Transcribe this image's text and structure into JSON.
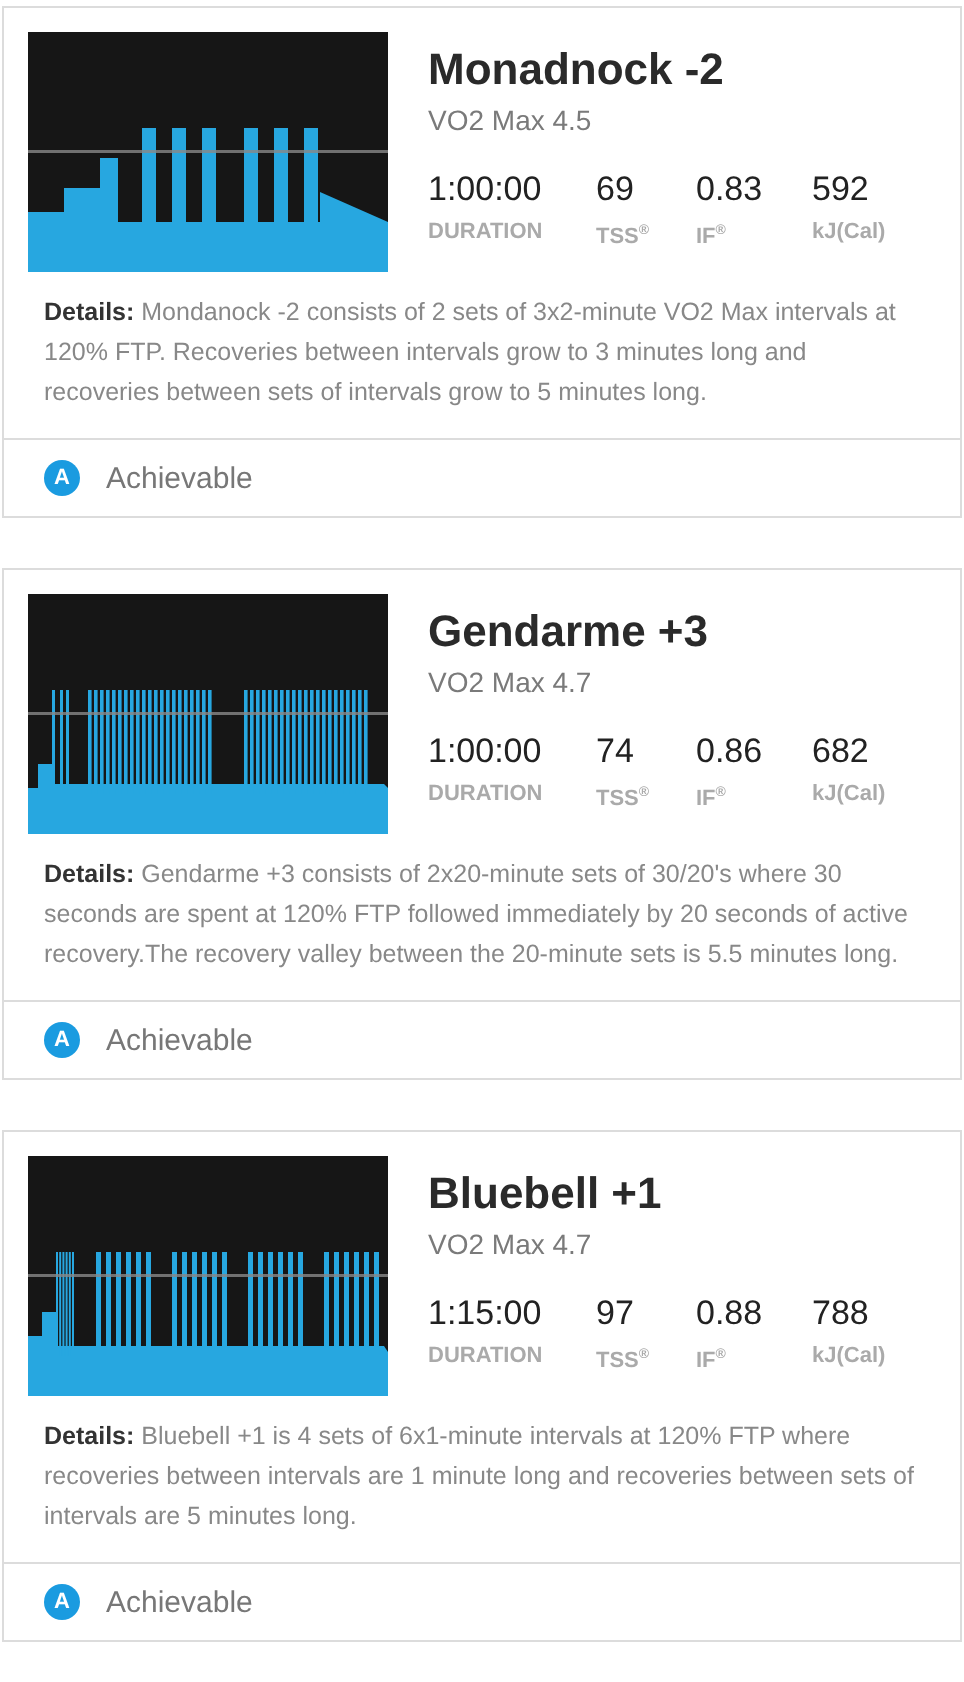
{
  "workouts": [
    {
      "title": "Monadnock -2",
      "subtitle": "VO2 Max 4.5",
      "stats": [
        {
          "value": "1:00:00",
          "label": "DURATION"
        },
        {
          "value": "69",
          "label": "TSS$^{®}$"
        },
        {
          "value": "0.83",
          "label": "IF$^{®}$"
        },
        {
          "value": "592",
          "label": "kJ(Cal)"
        }
      ],
      "details": "**Details:** Mondanock -2 consists of 2 sets of 3x2-minute VO2 Max intervals at 120% FTP. Recoveries between intervals grow to 3 minutes long and recoveries between sets of intervals grow to 5 minutes long.",
      "badge": "A",
      "difficulty": "Achievable"
    },
    {
      "title": "Gendarme +3",
      "subtitle": "VO2 Max 4.7",
      "stats": [
        {
          "value": "1:00:00",
          "label": "DURATION"
        },
        {
          "value": "74",
          "label": "TSS$^{®}$"
        },
        {
          "value": "0.86",
          "label": "IF$^{®}$"
        },
        {
          "value": "682",
          "label": "kJ(Cal)"
        }
      ],
      "details": "**Details:** Gendarme +3 consists of 2x20-minute sets of 30/20's where 30 seconds are spent at 120% FTP followed immediately by 20 seconds of active recovery.The recovery valley between the 20-minute sets is 5.5 minutes long.",
      "badge": "A",
      "difficulty": "Achievable"
    },
    {
      "title": "Bluebell +1",
      "subtitle": "VO2 Max 4.7",
      "stats": [
        {
          "value": "1:15:00",
          "label": "DURATION"
        },
        {
          "value": "97",
          "label": "TSS$^{®}$"
        },
        {
          "value": "0.88",
          "label": "IF$^{®}$"
        },
        {
          "value": "788",
          "label": "kJ(Cal)"
        }
      ],
      "details": "**Details:** Bluebell +1 is 4 sets of 6x1-minute intervals at 120% FTP where recoveries between intervals are 1 minute long and recoveries between sets of intervals are 5 minutes long.",
      "badge": "A",
      "difficulty": "Achievable"
    }
  ]
}
